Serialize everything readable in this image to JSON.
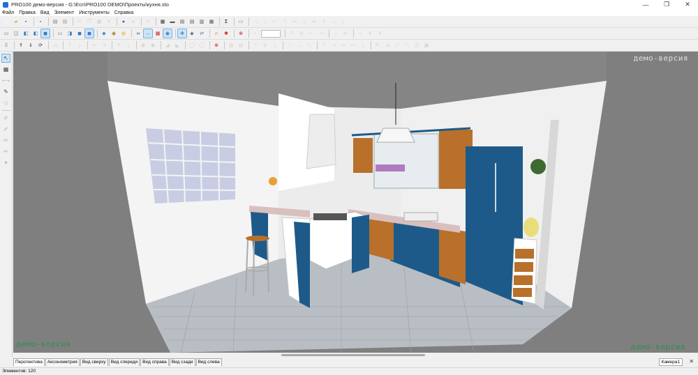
{
  "window": {
    "title": "PRO100 демо-версия - G:\\Ecn\\PRO100 DEMO\\Проекты\\кухня.sto",
    "minimize": "—",
    "maximize": "❐",
    "close": "✕"
  },
  "menu": [
    "Файл",
    "Правка",
    "Вид",
    "Элемент",
    "Инструменты",
    "Справка"
  ],
  "toolbar1": [
    {
      "icon": "new-file-icon",
      "glyph": "▯",
      "color": "#ffffff"
    },
    {
      "icon": "open-folder-icon",
      "glyph": "▰",
      "color": "#e0b84a"
    },
    {
      "icon": "save-icon",
      "glyph": "▪",
      "color": "#3b6fb6"
    },
    {
      "icon": "sep"
    },
    {
      "icon": "save-copy-icon",
      "glyph": "▪",
      "color": "#5a7fb5"
    },
    {
      "icon": "sep"
    },
    {
      "icon": "print-icon",
      "glyph": "▤",
      "color": "#777777"
    },
    {
      "icon": "print-preview-icon",
      "glyph": "▤",
      "color": "#999999"
    },
    {
      "icon": "sep"
    },
    {
      "icon": "cut-icon",
      "glyph": "✂",
      "color": "#999999",
      "disabled": true
    },
    {
      "icon": "copy-icon",
      "glyph": "❐",
      "color": "#999999",
      "disabled": true
    },
    {
      "icon": "paste-icon",
      "glyph": "▦",
      "color": "#999999",
      "disabled": true
    },
    {
      "icon": "delete-icon",
      "glyph": "✕",
      "color": "#999999",
      "disabled": true
    },
    {
      "icon": "sep"
    },
    {
      "icon": "globe-icon",
      "glyph": "●",
      "color": "#2b6cc4"
    },
    {
      "icon": "render-icon",
      "glyph": "●",
      "color": "#aaaaaa",
      "disabled": true
    },
    {
      "icon": "sep"
    },
    {
      "icon": "undo-icon",
      "glyph": "↶",
      "color": "#999999",
      "disabled": true
    },
    {
      "icon": "sep"
    },
    {
      "icon": "project-icon",
      "glyph": "▦",
      "color": "#333333"
    },
    {
      "icon": "panel-icon",
      "glyph": "▬",
      "color": "#555555"
    },
    {
      "icon": "library-icon",
      "glyph": "▤",
      "color": "#555555"
    },
    {
      "icon": "catalog-icon",
      "glyph": "▤",
      "color": "#555555"
    },
    {
      "icon": "materials-icon",
      "glyph": "▥",
      "color": "#555555"
    },
    {
      "icon": "report-icon",
      "glyph": "▦",
      "color": "#555555"
    },
    {
      "icon": "sep"
    },
    {
      "icon": "sum-icon",
      "glyph": "Σ",
      "color": "#000000"
    },
    {
      "icon": "sep"
    },
    {
      "icon": "screenshot-icon",
      "glyph": "▭",
      "color": "#888888"
    },
    {
      "icon": "sep"
    },
    {
      "icon": "align-left-icon",
      "glyph": "⊣",
      "color": "#999999",
      "disabled": true
    },
    {
      "icon": "align-center-icon",
      "glyph": "⊥",
      "color": "#999999",
      "disabled": true
    },
    {
      "icon": "align-right-icon",
      "glyph": "⊢",
      "color": "#999999",
      "disabled": true
    },
    {
      "icon": "align-top-icon",
      "glyph": "⊤",
      "color": "#999999",
      "disabled": true
    },
    {
      "icon": "align-middle-icon",
      "glyph": "═",
      "color": "#999999",
      "disabled": true
    },
    {
      "icon": "align-bottom-icon",
      "glyph": "⊥",
      "color": "#999999",
      "disabled": true
    },
    {
      "icon": "distribute-h-icon",
      "glyph": "⇹",
      "color": "#999999",
      "disabled": true
    },
    {
      "icon": "distribute-v-icon",
      "glyph": "⇳",
      "color": "#999999",
      "disabled": true
    },
    {
      "icon": "same-width-icon",
      "glyph": "↔",
      "color": "#999999",
      "disabled": true
    },
    {
      "icon": "same-height-icon",
      "glyph": "↕",
      "color": "#999999",
      "disabled": true
    }
  ],
  "toolbar2": [
    {
      "icon": "view-front-icon",
      "glyph": "▭",
      "color": "#666666"
    },
    {
      "icon": "view-iso-icon",
      "glyph": "◫",
      "color": "#3a78c0"
    },
    {
      "icon": "view-shade-icon",
      "glyph": "◧",
      "color": "#3a78c0"
    },
    {
      "icon": "view-shade2-icon",
      "glyph": "◧",
      "color": "#3a78c0"
    },
    {
      "icon": "view-solid-icon",
      "glyph": "◼",
      "color": "#3a78c0",
      "selected": true
    },
    {
      "icon": "sep"
    },
    {
      "icon": "wire-icon",
      "glyph": "▭",
      "color": "#666666"
    },
    {
      "icon": "hidden-line-icon",
      "glyph": "◨",
      "color": "#3a78c0"
    },
    {
      "icon": "shaded-icon",
      "glyph": "◼",
      "color": "#3a78c0"
    },
    {
      "icon": "textured-icon",
      "glyph": "◼",
      "color": "#3a78c0",
      "selected": true
    },
    {
      "icon": "sep"
    },
    {
      "icon": "cube-icon",
      "glyph": "◆",
      "color": "#4a8ad0"
    },
    {
      "icon": "material-icon",
      "glyph": "◉",
      "color": "#b0752a"
    },
    {
      "icon": "light-icon",
      "glyph": "◍",
      "color": "#e0b020"
    },
    {
      "icon": "sep"
    },
    {
      "icon": "link-icon",
      "glyph": "∞",
      "color": "#444444"
    },
    {
      "icon": "dimension-icon",
      "glyph": "↔",
      "color": "#3a78c0",
      "selected": true
    },
    {
      "icon": "grid-icon",
      "glyph": "▦",
      "color": "#cc2222"
    },
    {
      "icon": "snap-icon",
      "glyph": "◉",
      "color": "#3a78c0",
      "selected": true
    },
    {
      "icon": "sep"
    },
    {
      "icon": "move-icon",
      "glyph": "✥",
      "color": "#3a78c0",
      "selected": true
    },
    {
      "icon": "rotate-icon",
      "glyph": "◈",
      "color": "#444444"
    },
    {
      "icon": "flip-icon",
      "glyph": "⇄",
      "color": "#3a78c0"
    },
    {
      "icon": "sep"
    },
    {
      "icon": "magnet-icon",
      "glyph": "∩",
      "color": "#cc2222"
    },
    {
      "icon": "collision-icon",
      "glyph": "✱",
      "color": "#cc2222"
    },
    {
      "icon": "sep"
    },
    {
      "icon": "stop-icon",
      "glyph": "⊗",
      "color": "#cc2222"
    },
    {
      "icon": "sep"
    },
    {
      "icon": "zoom-icon",
      "glyph": "⌕",
      "color": "#999999",
      "disabled": true
    },
    {
      "icon": "zoom-field",
      "field": true
    },
    {
      "icon": "sep"
    },
    {
      "icon": "move-up-icon",
      "glyph": "⇡",
      "color": "#999999",
      "disabled": true
    },
    {
      "icon": "move-eye-icon",
      "glyph": "◎",
      "color": "#999999",
      "disabled": true
    },
    {
      "icon": "move-left-icon",
      "glyph": "⇠",
      "color": "#999999",
      "disabled": true
    },
    {
      "icon": "move-right-icon",
      "glyph": "⇢",
      "color": "#999999",
      "disabled": true
    },
    {
      "icon": "sep"
    },
    {
      "icon": "spread-h-icon",
      "glyph": "↔",
      "color": "#999999",
      "disabled": true
    },
    {
      "icon": "spread-v-icon",
      "glyph": "⇆",
      "color": "#999999",
      "disabled": true
    },
    {
      "icon": "sep"
    },
    {
      "icon": "stretch-v-icon",
      "glyph": "↕",
      "color": "#999999",
      "disabled": true
    },
    {
      "icon": "stretch-up-icon",
      "glyph": "⇞",
      "color": "#999999",
      "disabled": true
    },
    {
      "icon": "stretch-down-icon",
      "glyph": "⇟",
      "color": "#999999",
      "disabled": true
    }
  ],
  "toolbar3": [
    {
      "icon": "grid-dots-icon",
      "glyph": "⁞⁞",
      "color": "#333333"
    },
    {
      "icon": "sep"
    },
    {
      "icon": "up-arrow-icon",
      "glyph": "⇑",
      "color": "#333333"
    },
    {
      "icon": "down-arrow-icon",
      "glyph": "⇓",
      "color": "#333333"
    },
    {
      "icon": "rotate-cw-icon",
      "glyph": "⟳",
      "color": "#333333"
    },
    {
      "icon": "sep"
    },
    {
      "icon": "mirror-icon",
      "glyph": "◁",
      "color": "#999999",
      "disabled": true
    },
    {
      "icon": "sep"
    },
    {
      "icon": "lift-up-icon",
      "glyph": "⇡",
      "color": "#999999",
      "disabled": true
    },
    {
      "icon": "lower-icon",
      "glyph": "⇣",
      "color": "#999999",
      "disabled": true
    },
    {
      "icon": "sep"
    },
    {
      "icon": "push-left-icon",
      "glyph": "⇤",
      "color": "#999999",
      "disabled": true
    },
    {
      "icon": "push-right-icon",
      "glyph": "⇥",
      "color": "#999999",
      "disabled": true
    },
    {
      "icon": "sep"
    },
    {
      "icon": "push-back-icon",
      "glyph": "⤒",
      "color": "#999999",
      "disabled": true
    },
    {
      "icon": "push-front-icon",
      "glyph": "⤓",
      "color": "#999999",
      "disabled": true
    },
    {
      "icon": "sep"
    },
    {
      "icon": "eye-icon",
      "glyph": "◉",
      "color": "#999999",
      "disabled": true
    },
    {
      "icon": "eye2-icon",
      "glyph": "◉",
      "color": "#999999",
      "disabled": true
    },
    {
      "icon": "sep"
    },
    {
      "icon": "flip-left-icon",
      "glyph": "◢",
      "color": "#999999",
      "disabled": true
    },
    {
      "icon": "flip-right-icon",
      "glyph": "◣",
      "color": "#999999",
      "disabled": true
    },
    {
      "icon": "sep"
    },
    {
      "icon": "hide-icon",
      "glyph": "◯",
      "color": "#999999",
      "disabled": true
    },
    {
      "icon": "show-icon",
      "glyph": "◯",
      "color": "#999999",
      "disabled": true
    },
    {
      "icon": "sep"
    },
    {
      "icon": "stop2-icon",
      "glyph": "⊗",
      "color": "#cc2222"
    },
    {
      "icon": "sep"
    },
    {
      "icon": "same-size-icon",
      "glyph": "▥",
      "color": "#999999",
      "disabled": true
    },
    {
      "icon": "same-depth-icon",
      "glyph": "▤",
      "color": "#999999",
      "disabled": true
    },
    {
      "icon": "sep"
    },
    {
      "icon": "top-dist-icon",
      "glyph": "⊤",
      "color": "#999999",
      "disabled": true
    },
    {
      "icon": "mid-dist-icon",
      "glyph": "╪",
      "color": "#999999",
      "disabled": true
    },
    {
      "icon": "bottom-dist-icon",
      "glyph": "⊥",
      "color": "#999999",
      "disabled": true
    },
    {
      "icon": "sep"
    },
    {
      "icon": "height-icon",
      "glyph": "↕",
      "color": "#999999",
      "disabled": true
    },
    {
      "icon": "width-icon",
      "glyph": "↔",
      "color": "#999999",
      "disabled": true
    },
    {
      "icon": "depth-icon",
      "glyph": "⤡",
      "color": "#999999",
      "disabled": true
    },
    {
      "icon": "sep"
    },
    {
      "icon": "align-top2-icon",
      "glyph": "⊤",
      "color": "#999999",
      "disabled": true
    },
    {
      "icon": "align-left2-icon",
      "glyph": "⊣",
      "color": "#999999",
      "disabled": true
    },
    {
      "icon": "align-mid2-icon",
      "glyph": "═",
      "color": "#999999",
      "disabled": true
    },
    {
      "icon": "align-right2-icon",
      "glyph": "⊢",
      "color": "#999999",
      "disabled": true
    },
    {
      "icon": "align-bot2-icon",
      "glyph": "⊥",
      "color": "#999999",
      "disabled": true
    },
    {
      "icon": "sep"
    },
    {
      "icon": "collapse-icon",
      "glyph": "⇱",
      "color": "#999999",
      "disabled": true
    },
    {
      "icon": "expand-icon",
      "glyph": "⇲",
      "color": "#999999",
      "disabled": true
    },
    {
      "icon": "fit-icon",
      "glyph": "⤢",
      "color": "#999999",
      "disabled": true
    },
    {
      "icon": "fit2-icon",
      "glyph": "⤡",
      "color": "#999999",
      "disabled": true
    },
    {
      "icon": "fit3-icon",
      "glyph": "◫",
      "color": "#999999",
      "disabled": true
    },
    {
      "icon": "fit4-icon",
      "glyph": "▣",
      "color": "#999999",
      "disabled": true
    }
  ],
  "left_toolbar": [
    {
      "icon": "select-arrow-icon",
      "glyph": "↖",
      "selected": true
    },
    {
      "icon": "wall-tool-icon",
      "glyph": "▦"
    },
    {
      "icon": "measure-icon",
      "glyph": "⟷",
      "disabled": true
    },
    {
      "icon": "eyedropper-icon",
      "glyph": "✎"
    },
    {
      "icon": "eraser-icon",
      "glyph": "◇",
      "disabled": true
    },
    {
      "icon": "sep"
    },
    {
      "icon": "brush-icon",
      "glyph": "✐",
      "disabled": true
    },
    {
      "icon": "brush2-icon",
      "glyph": "✐",
      "disabled": true
    },
    {
      "icon": "pencil-icon",
      "glyph": "✏",
      "disabled": true
    },
    {
      "icon": "pencil2-icon",
      "glyph": "✏",
      "disabled": true
    },
    {
      "icon": "texture-icon",
      "glyph": "✦",
      "disabled": true
    }
  ],
  "viewport": {
    "watermark": "демо-версия",
    "colors": {
      "background": "#7f7f7f",
      "ceiling": "#8a8a8a",
      "left_wall": "#f4f4f4",
      "back_wall": "#ececec",
      "floor": "#b9bdc4",
      "cabinet_blue": "#1d5a8a",
      "cabinet_wood": "#b8702a",
      "countertop": "#d9bfbd"
    }
  },
  "view_tabs": [
    "Перспектива",
    "Аксонометрия",
    "Вид сверху",
    "Вид спереди",
    "Вид справа",
    "Вид сзади",
    "Вид слева"
  ],
  "camera_tab": "Камера1",
  "camera_close": "✕",
  "status": "Элементов: 120"
}
